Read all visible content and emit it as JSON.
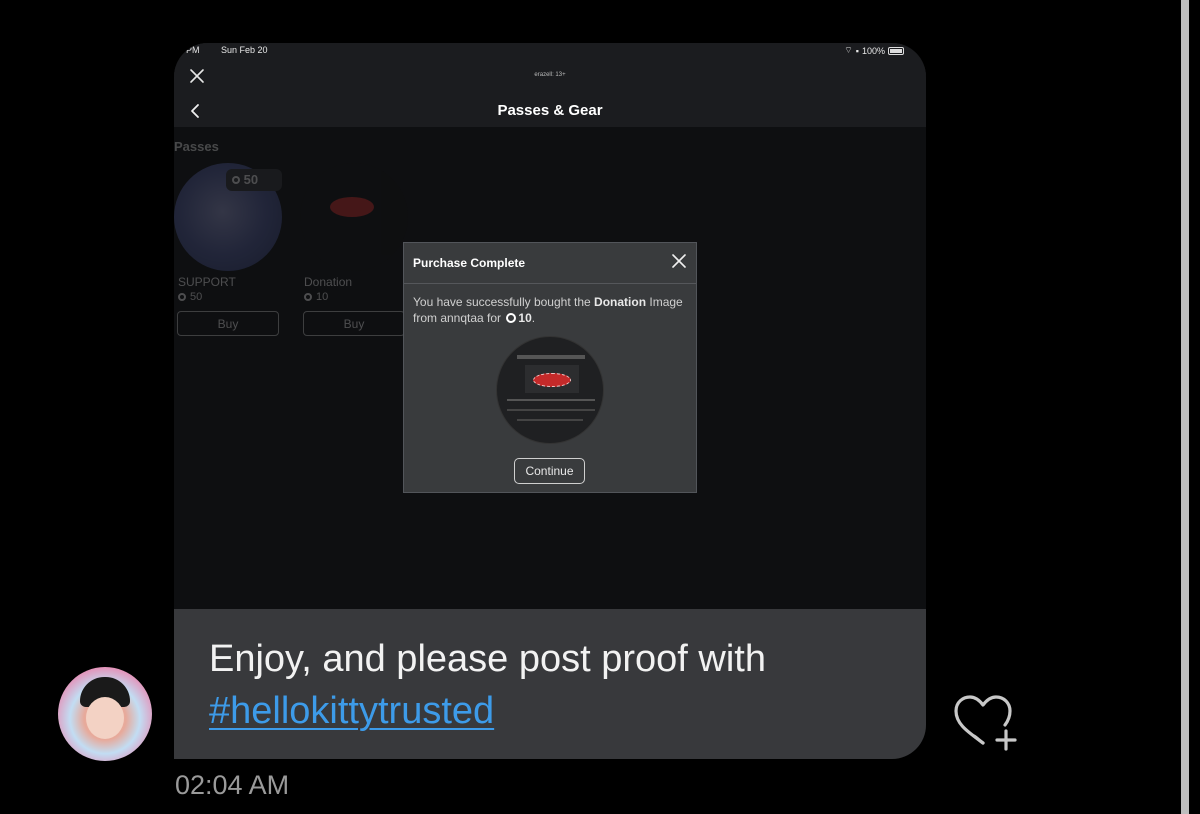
{
  "status_bar": {
    "time": "PM",
    "date": "Sun Feb 20",
    "battery": "100%"
  },
  "header": {
    "account_label": "erazell: 13+",
    "title": "Passes & Gear"
  },
  "passes": {
    "section_title": "Passes",
    "items": [
      {
        "name": "SUPPORT",
        "price": "50",
        "chip_price": "50",
        "buy_label": "Buy"
      },
      {
        "name": "Donation",
        "price": "10",
        "buy_label": "Buy"
      }
    ]
  },
  "dialog": {
    "title": "Purchase Complete",
    "body_prefix": "You have successfully bought the",
    "item_name": "Donation",
    "body_middle": "Image from annqtaa for",
    "amount": "10",
    "body_suffix": ".",
    "continue_label": "Continue"
  },
  "message": {
    "text": "Enjoy, and please post proof with",
    "hashtag": "#hellokittytrusted",
    "timestamp": "02:04 AM"
  }
}
